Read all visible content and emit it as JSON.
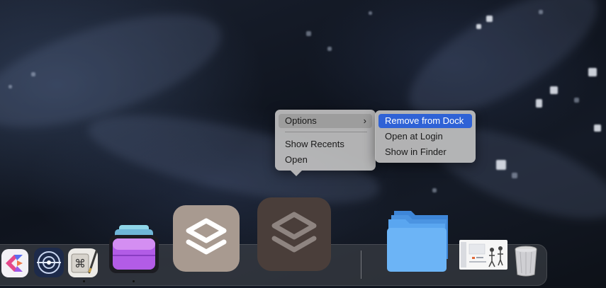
{
  "context_menu": {
    "items": [
      {
        "label": "Options",
        "has_submenu": true,
        "submenu_glyph": "›"
      },
      {
        "label": "Show Recents"
      },
      {
        "label": "Open"
      }
    ]
  },
  "submenu": {
    "items": [
      {
        "label": "Remove from Dock",
        "selected": true
      },
      {
        "label": "Open at Login"
      },
      {
        "label": "Show in Finder"
      }
    ]
  },
  "dock": {
    "apps": [
      {
        "name": "craft-app-icon",
        "running": false
      },
      {
        "name": "network-radar-icon",
        "running": false
      },
      {
        "name": "keyboard-shortcuts-icon",
        "running": true
      },
      {
        "name": "purple-stack-app-icon",
        "running": true
      },
      {
        "name": "shortcuts-app-icon",
        "running": false
      },
      {
        "name": "shortcuts-app-icon",
        "running": false,
        "state": "dragging"
      },
      {
        "name": "folder-stack-icon"
      },
      {
        "name": "document-thumbnail-icon"
      },
      {
        "name": "trash-icon"
      }
    ]
  },
  "colors": {
    "selected_highlight": "#2f62d6",
    "menu_background": "#bebebe",
    "folder_blue": "#5aa6f0",
    "purple_app": "#b25ce6"
  }
}
